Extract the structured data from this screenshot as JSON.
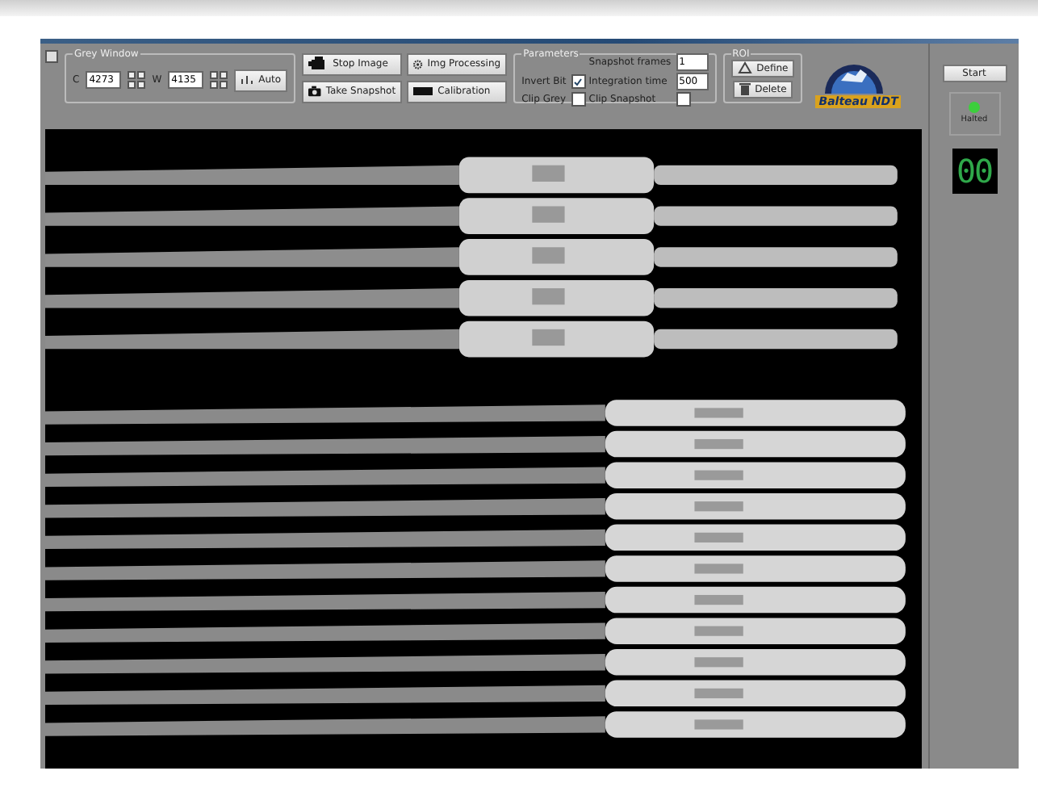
{
  "grey_window": {
    "title": "Grey Window",
    "fields": [
      {
        "label": "C",
        "value": "4273"
      },
      {
        "label": "W",
        "value": "4135"
      }
    ],
    "auto_button": "Auto"
  },
  "actions": [
    {
      "label": "Stop Image",
      "kind": "video"
    },
    {
      "label": "Img Processing",
      "kind": "gear"
    },
    {
      "label": "Take Snapshot",
      "kind": "camera"
    },
    {
      "label": "Calibration",
      "kind": "bar"
    }
  ],
  "parameters": {
    "title": "Parameters",
    "fields": [
      {
        "label": "Snapshot frames",
        "value": "1"
      },
      {
        "label": "Integration time",
        "value": "500"
      }
    ],
    "checks": [
      {
        "label": "Invert Bit",
        "checked": true
      },
      {
        "label": "Clip Grey",
        "checked": false
      },
      {
        "label": "Clip Snapshot",
        "checked": false
      }
    ]
  },
  "roi": {
    "title": "ROI",
    "buttons": [
      {
        "label": "Define",
        "kind": "define"
      },
      {
        "label": "Delete",
        "kind": "delete"
      }
    ]
  },
  "logo": {
    "text": "Balteau NDT"
  },
  "side": {
    "start_button": "Start",
    "status": "Halted",
    "led_on": true,
    "counter": "00"
  }
}
